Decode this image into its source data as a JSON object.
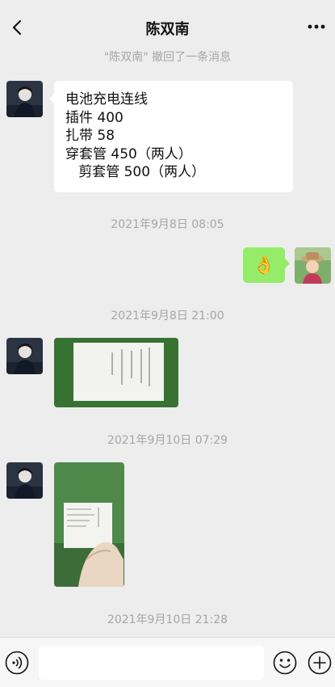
{
  "header": {
    "title": "陈双南",
    "back_icon": "chevron-left-icon",
    "more_icon": "more-dots-icon"
  },
  "chat": {
    "system_message": "\"陈双南\" 撤回了一条消息",
    "text_message": {
      "lines": [
        "电池充电连线",
        "插件 400",
        "扎带 58",
        "穿套管 450（两人）",
        "   剪套管 500（两人）"
      ]
    },
    "timestamps": [
      "2021年9月8日 08:05",
      "2021年9月8日 21:00",
      "2021年9月10日 07:29",
      "2021年9月10日 21:28"
    ],
    "emoji_message": "👌"
  },
  "input_bar": {
    "placeholder": "",
    "voice_icon": "voice-icon",
    "emoji_icon": "emoji-icon",
    "plus_icon": "plus-icon"
  },
  "colors": {
    "background": "#ededed",
    "my_bubble": "#95ec69",
    "other_bubble": "#ffffff",
    "meta_text": "#a6a6a6"
  }
}
